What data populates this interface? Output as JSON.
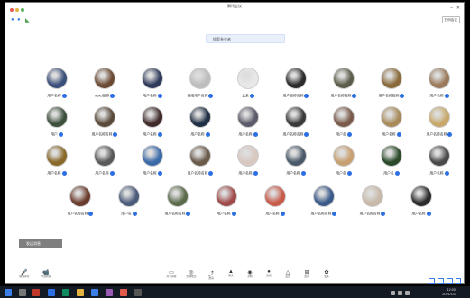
{
  "window": {
    "title": "腾讯会议"
  },
  "toolbar_right": {
    "view_label": "扫码会议"
  },
  "search": {
    "placeholder": "搜索参会者"
  },
  "participants": [
    {
      "name": "用户名称",
      "color": "#3a4f7a"
    },
    {
      "name": "Neko昵称",
      "color": "#6b4a33"
    },
    {
      "name": "用户名称",
      "color": "#2d3a5a"
    },
    {
      "name": "网络用户名称",
      "color": "#bdbdbd"
    },
    {
      "name": "云朵",
      "color": "#e8e8e8"
    },
    {
      "name": "用户昵称名称",
      "color": "#2b2b2b"
    },
    {
      "name": "用户名称昵称",
      "color": "#5c5c4a"
    },
    {
      "name": "用户名称昵称",
      "color": "#8a6a3a"
    },
    {
      "name": "用户名称",
      "color": "#9a7a5a"
    },
    {
      "name": "用户",
      "color": "#3d4f3d"
    },
    {
      "name": "用户名称名称",
      "color": "#5a4a3a"
    },
    {
      "name": "用户名称",
      "color": "#402a2a"
    },
    {
      "name": "用户名称",
      "color": "#1f2f44"
    },
    {
      "name": "用户名称",
      "color": "#5a5a6a"
    },
    {
      "name": "用户名称名称",
      "color": "#3a3a3a"
    },
    {
      "name": "用户名",
      "color": "#7a5a4a"
    },
    {
      "name": "用户名称",
      "color": "#a88a5a"
    },
    {
      "name": "用户名称名称",
      "color": "#c8a86a"
    },
    {
      "name": "用户名称",
      "color": "#8a6a2a"
    },
    {
      "name": "用户名称",
      "color": "#5a5a5a"
    },
    {
      "name": "用户名称",
      "color": "#3a6aa8"
    },
    {
      "name": "用户名称名称",
      "color": "#6a5a4a"
    },
    {
      "name": "用户名称",
      "color": "#d8c8c0"
    },
    {
      "name": "用户名称",
      "color": "#4a5a6a"
    },
    {
      "name": "用户名",
      "color": "#c8a070"
    },
    {
      "name": "用户名",
      "color": "#2a4a2a"
    },
    {
      "name": "用户名称",
      "color": "#4a4a4a"
    },
    {
      "name": "用户名称名称",
      "color": "#6a3a2a"
    },
    {
      "name": "用户名",
      "color": "#4a5a7a"
    },
    {
      "name": "用户名称名称",
      "color": "#5a6a4a"
    },
    {
      "name": "用户名称",
      "color": "#a04a4a"
    },
    {
      "name": "用户名称",
      "color": "#c85a4a"
    },
    {
      "name": "用户名称名称",
      "color": "#3a5a8a"
    },
    {
      "name": "用户名称名称",
      "color": "#c8b8a8"
    },
    {
      "name": "用户名称",
      "color": "#2a2a2a"
    }
  ],
  "chat": {
    "label": "发送消息"
  },
  "controls": {
    "mic": {
      "label": "解除静音"
    },
    "video": {
      "label": "开启视频"
    },
    "items": [
      {
        "label": "共享屏幕",
        "glyph": "▭"
      },
      {
        "label": "管理成员",
        "glyph": "◎"
      },
      {
        "label": "邀请",
        "glyph": "⤴"
      },
      {
        "label": "聊天",
        "glyph": "▲"
      },
      {
        "label": "录制",
        "glyph": "◉"
      },
      {
        "label": "应用",
        "glyph": "●"
      },
      {
        "label": "设置",
        "glyph": "△"
      },
      {
        "label": "会议",
        "glyph": "⊞"
      },
      {
        "label": "更多",
        "glyph": "✿"
      }
    ]
  },
  "taskbar": {
    "time": "12:00",
    "date": "2021/1/1"
  },
  "colors": {
    "accent": "#2d6fe3",
    "taskbar": "#141a24"
  }
}
